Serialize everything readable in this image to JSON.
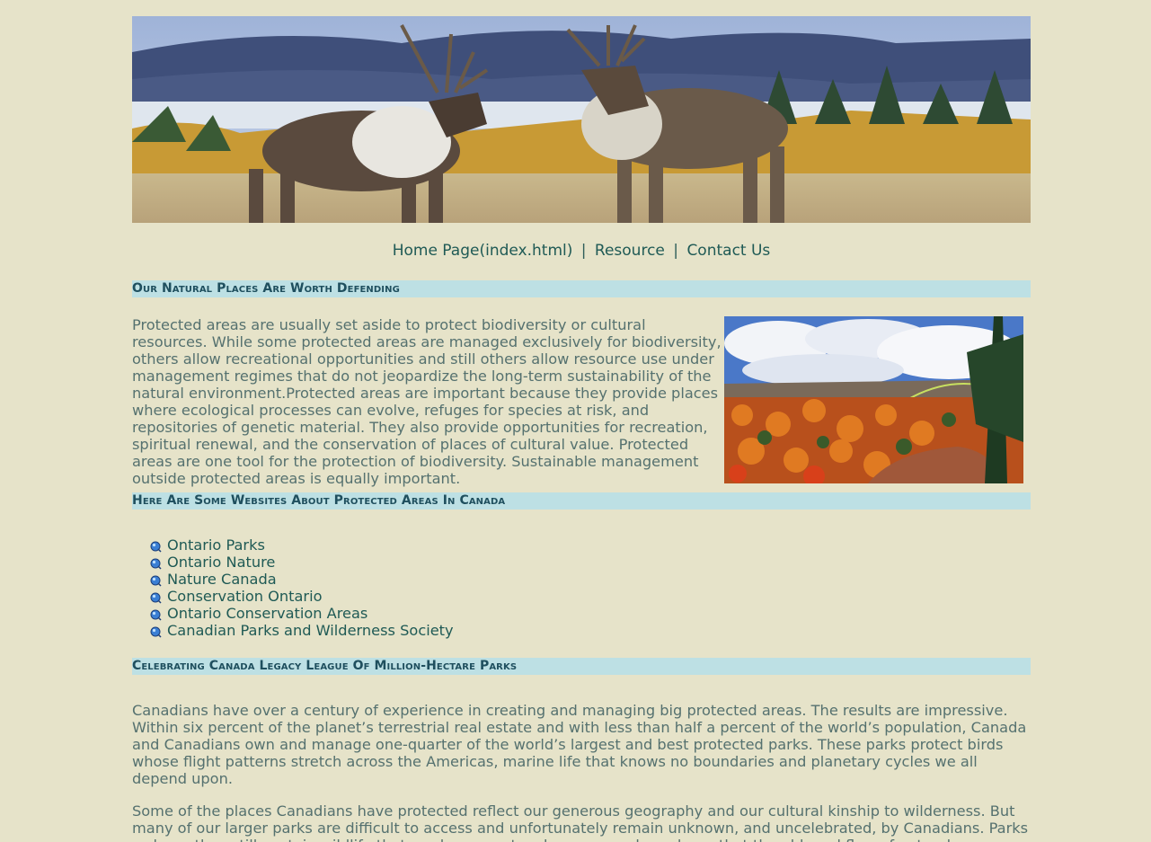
{
  "nav": {
    "home": "Home Page(index.html)",
    "resource": "Resource",
    "contact": "Contact Us",
    "separator": "|"
  },
  "sections": {
    "natural_places": {
      "heading": "Our Natural Places Are Worth Defending",
      "text": "Protected areas are usually set aside to protect biodiversity or cultural resources. While some protected areas are managed exclusively for biodiversity, others allow recreational opportunities and still others allow resource use under management regimes that do not jeopardize the long-term sustainability of the natural environment.Protected areas are important because they provide places where ecological processes can evolve, refuges for species at risk, and repositories of genetic material. They also provide opportunities for recreation, spiritual renewal, and the conservation of places of cultural value. Protected areas are one tool for the protection of biodiversity. Sustainable management outside protected areas is equally important."
    },
    "websites": {
      "heading": "Here Are Some Websites About Protected Areas In Canada",
      "links": [
        "Ontario Parks",
        "Ontario Nature",
        "Nature Canada",
        "Conservation Ontario",
        "Ontario Conservation Areas",
        "Canadian Parks and Wilderness Society"
      ]
    },
    "legacy": {
      "heading": "Celebrating Canada Legacy League Of Million-Hectare Parks",
      "para1": "Canadians have over a century of experience in creating and managing big protected areas. The results are impressive. Within six percent of the planet’s terrestrial real estate and with less than half a percent of the world’s population, Canada and Canadians own and manage one-quarter of the world’s largest and best protected parks. These parks protect birds whose flight patterns stretch across the Americas, marine life that knows no boundaries and planetary cycles we all depend upon.",
      "para2": "Some of the places Canadians have protected reflect our generous geography and our cultural kinship to wilderness. But many of our larger parks are difficult to access and unfortunately remain unknown, and uncelebrated, by Canadians. Parks so large they still contain wildlife that rarely encounters humans; parks so large that the ebb and flow of natural processes"
    }
  },
  "icons": {
    "bullet": "globe-bullet-icon"
  }
}
